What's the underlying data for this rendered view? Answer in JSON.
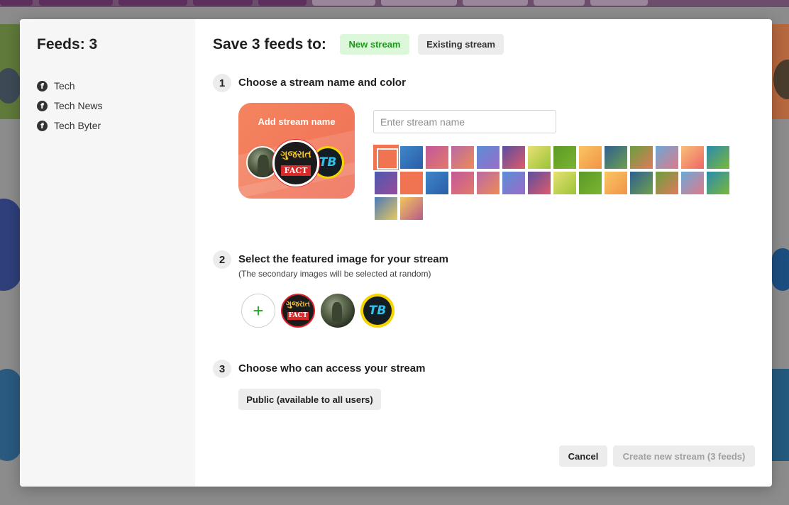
{
  "sidebar": {
    "title": "Feeds: 3",
    "feeds": [
      {
        "label": "Tech",
        "icon": "facebook-icon"
      },
      {
        "label": "Tech News",
        "icon": "facebook-icon"
      },
      {
        "label": "Tech Byter",
        "icon": "facebook-icon"
      }
    ]
  },
  "header": {
    "title": "Save 3 feeds to:",
    "tabs": {
      "new_stream": "New stream",
      "existing_stream": "Existing stream"
    }
  },
  "step1": {
    "number": "1",
    "title": "Choose a stream name and color",
    "preview_label": "Add stream name",
    "input_placeholder": "Enter stream name",
    "input_value": "",
    "selected_color": "#f07452"
  },
  "step2": {
    "number": "2",
    "title": "Select the featured image for your stream",
    "subtitle": "(The secondary images will be selected at random)",
    "add_symbol": "+"
  },
  "step3": {
    "number": "3",
    "title": "Choose who can access your stream",
    "access_label": "Public (available to all users)"
  },
  "footer": {
    "cancel_label": "Cancel",
    "create_label": "Create new stream (3 feeds)"
  },
  "colors": {
    "new_stream_bg": "#dcf7d9",
    "new_stream_text": "#1a9a1a",
    "accent_green": "#1faa1f"
  },
  "avatar_text": {
    "fact_top": "ગુજરાત",
    "fact_bar": "FACT",
    "tb": "TB"
  }
}
